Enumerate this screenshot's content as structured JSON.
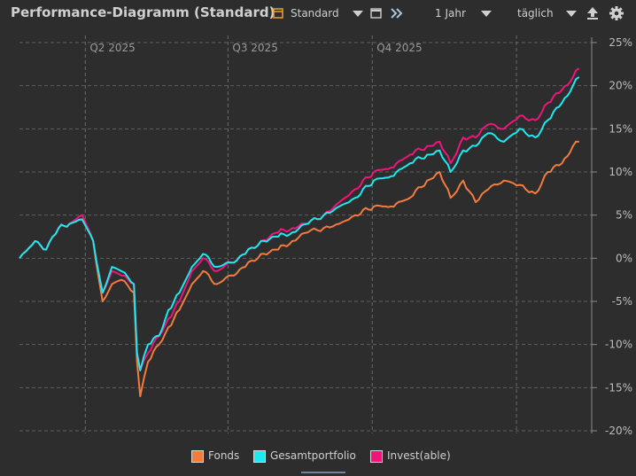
{
  "header": {
    "title": "Performance-Diagramm (Standard)",
    "view_select": "Standard",
    "period_select": "1 Jahr",
    "interval_select": "täglich"
  },
  "icons": [
    "calendar-icon",
    "chevron-down-icon",
    "window-icon",
    "double-chevron-right-icon",
    "export-icon",
    "gear-icon"
  ],
  "chart_data": {
    "type": "line",
    "x_range": [
      "2025-02-18",
      "2026-02-18"
    ],
    "quarter_labels": [
      {
        "label": "Q2 2025",
        "date": "2025-04-01"
      },
      {
        "label": "Q3 2025",
        "date": "2025-07-01"
      },
      {
        "label": "Q4 2025",
        "date": "2025-10-01"
      }
    ],
    "y_ticks": [
      "25%",
      "20%",
      "15%",
      "10%",
      "5%",
      "0%",
      "-5%",
      "-10%",
      "-15%",
      "-20%"
    ],
    "y_tick_values": [
      25,
      20,
      15,
      10,
      5,
      0,
      -5,
      -10,
      -15,
      -20
    ],
    "ylim": [
      -20,
      25
    ],
    "grid": true,
    "legend_position": "bottom",
    "series": [
      {
        "name": "Fonds",
        "color": "#f47b3e",
        "points": [
          [
            "2025-02-18",
            0
          ],
          [
            "2025-02-28",
            2
          ],
          [
            "2025-03-07",
            1
          ],
          [
            "2025-03-15",
            3.5
          ],
          [
            "2025-03-22",
            4
          ],
          [
            "2025-03-30",
            4.5
          ],
          [
            "2025-04-06",
            2
          ],
          [
            "2025-04-12",
            -5
          ],
          [
            "2025-04-18",
            -3
          ],
          [
            "2025-04-24",
            -2.5
          ],
          [
            "2025-05-02",
            -4
          ],
          [
            "2025-05-04",
            -12
          ],
          [
            "2025-05-06",
            -16
          ],
          [
            "2025-05-11",
            -12
          ],
          [
            "2025-05-18",
            -10
          ],
          [
            "2025-05-24",
            -8
          ],
          [
            "2025-05-31",
            -6
          ],
          [
            "2025-06-08",
            -3
          ],
          [
            "2025-06-15",
            -1.5
          ],
          [
            "2025-06-24",
            -3
          ],
          [
            "2025-07-03",
            -2
          ],
          [
            "2025-07-12",
            -1
          ],
          [
            "2025-07-22",
            0.5
          ],
          [
            "2025-08-02",
            1
          ],
          [
            "2025-08-11",
            2
          ],
          [
            "2025-08-21",
            3
          ],
          [
            "2025-08-31",
            3.5
          ],
          [
            "2025-09-10",
            4
          ],
          [
            "2025-09-20",
            5
          ],
          [
            "2025-10-02",
            6
          ],
          [
            "2025-10-13",
            6
          ],
          [
            "2025-10-25",
            7
          ],
          [
            "2025-11-05",
            9
          ],
          [
            "2025-11-13",
            10
          ],
          [
            "2025-11-20",
            7
          ],
          [
            "2025-11-28",
            9
          ],
          [
            "2025-12-06",
            6.5
          ],
          [
            "2025-12-14",
            8
          ],
          [
            "2025-12-24",
            9
          ],
          [
            "2026-01-03",
            8.5
          ],
          [
            "2026-01-13",
            7.5
          ],
          [
            "2026-01-21",
            10
          ],
          [
            "2026-01-30",
            11
          ],
          [
            "2026-02-06",
            13
          ],
          [
            "2026-02-10",
            13.5
          ]
        ]
      },
      {
        "name": "Gesamtportfolio",
        "color": "#1ee8f0",
        "points": [
          [
            "2025-02-18",
            0
          ],
          [
            "2025-02-28",
            2
          ],
          [
            "2025-03-07",
            1
          ],
          [
            "2025-03-15",
            3.5
          ],
          [
            "2025-03-22",
            4
          ],
          [
            "2025-03-30",
            4.5
          ],
          [
            "2025-04-06",
            2
          ],
          [
            "2025-04-12",
            -4
          ],
          [
            "2025-04-18",
            -1
          ],
          [
            "2025-04-24",
            -1.5
          ],
          [
            "2025-05-02",
            -3
          ],
          [
            "2025-05-04",
            -11
          ],
          [
            "2025-05-06",
            -13
          ],
          [
            "2025-05-11",
            -10
          ],
          [
            "2025-05-18",
            -9
          ],
          [
            "2025-05-24",
            -6
          ],
          [
            "2025-05-31",
            -4
          ],
          [
            "2025-06-08",
            -1
          ],
          [
            "2025-06-15",
            0.5
          ],
          [
            "2025-06-24",
            -1
          ],
          [
            "2025-07-03",
            -0.5
          ],
          [
            "2025-07-12",
            0.5
          ],
          [
            "2025-07-22",
            2
          ],
          [
            "2025-08-02",
            2.5
          ],
          [
            "2025-08-11",
            3
          ],
          [
            "2025-08-21",
            4
          ],
          [
            "2025-08-31",
            5
          ],
          [
            "2025-09-10",
            6
          ],
          [
            "2025-09-20",
            7
          ],
          [
            "2025-10-02",
            9
          ],
          [
            "2025-10-13",
            9.5
          ],
          [
            "2025-10-25",
            11
          ],
          [
            "2025-11-05",
            12
          ],
          [
            "2025-11-13",
            12.5
          ],
          [
            "2025-11-20",
            10
          ],
          [
            "2025-11-28",
            12.5
          ],
          [
            "2025-12-06",
            13
          ],
          [
            "2025-12-14",
            14.5
          ],
          [
            "2025-12-24",
            13.5
          ],
          [
            "2026-01-03",
            15
          ],
          [
            "2026-01-13",
            14
          ],
          [
            "2026-01-21",
            16
          ],
          [
            "2026-01-30",
            18
          ],
          [
            "2026-02-06",
            20
          ],
          [
            "2026-02-10",
            21
          ]
        ]
      },
      {
        "name": "Invest(able)",
        "color": "#f0157a",
        "points": [
          [
            "2025-02-18",
            0
          ],
          [
            "2025-02-28",
            2
          ],
          [
            "2025-03-07",
            1
          ],
          [
            "2025-03-15",
            3.5
          ],
          [
            "2025-03-22",
            4
          ],
          [
            "2025-03-30",
            5
          ],
          [
            "2025-04-06",
            2
          ],
          [
            "2025-04-12",
            -4
          ],
          [
            "2025-04-18",
            -1.5
          ],
          [
            "2025-04-24",
            -2
          ],
          [
            "2025-05-02",
            -3
          ],
          [
            "2025-05-04",
            -11
          ],
          [
            "2025-05-06",
            -13
          ],
          [
            "2025-05-11",
            -11
          ],
          [
            "2025-05-18",
            -9
          ],
          [
            "2025-05-24",
            -7
          ],
          [
            "2025-05-31",
            -5
          ],
          [
            "2025-06-08",
            -1.5
          ],
          [
            "2025-06-15",
            0
          ],
          [
            "2025-06-24",
            -1.5
          ],
          [
            "2025-07-03",
            -0.5
          ],
          [
            "2025-07-12",
            0.5
          ],
          [
            "2025-07-22",
            2
          ],
          [
            "2025-08-02",
            3
          ],
          [
            "2025-08-11",
            3.5
          ],
          [
            "2025-08-21",
            4
          ],
          [
            "2025-08-31",
            5
          ],
          [
            "2025-09-10",
            6.5
          ],
          [
            "2025-09-20",
            8
          ],
          [
            "2025-10-02",
            10
          ],
          [
            "2025-10-13",
            10.5
          ],
          [
            "2025-10-25",
            12
          ],
          [
            "2025-11-05",
            13
          ],
          [
            "2025-11-13",
            13.5
          ],
          [
            "2025-11-20",
            11
          ],
          [
            "2025-11-28",
            14
          ],
          [
            "2025-12-06",
            14
          ],
          [
            "2025-12-14",
            15.5
          ],
          [
            "2025-12-24",
            15
          ],
          [
            "2026-01-03",
            16.5
          ],
          [
            "2026-01-13",
            16
          ],
          [
            "2026-01-21",
            18
          ],
          [
            "2026-01-30",
            19.5
          ],
          [
            "2026-02-06",
            21
          ],
          [
            "2026-02-10",
            22
          ]
        ]
      }
    ]
  }
}
